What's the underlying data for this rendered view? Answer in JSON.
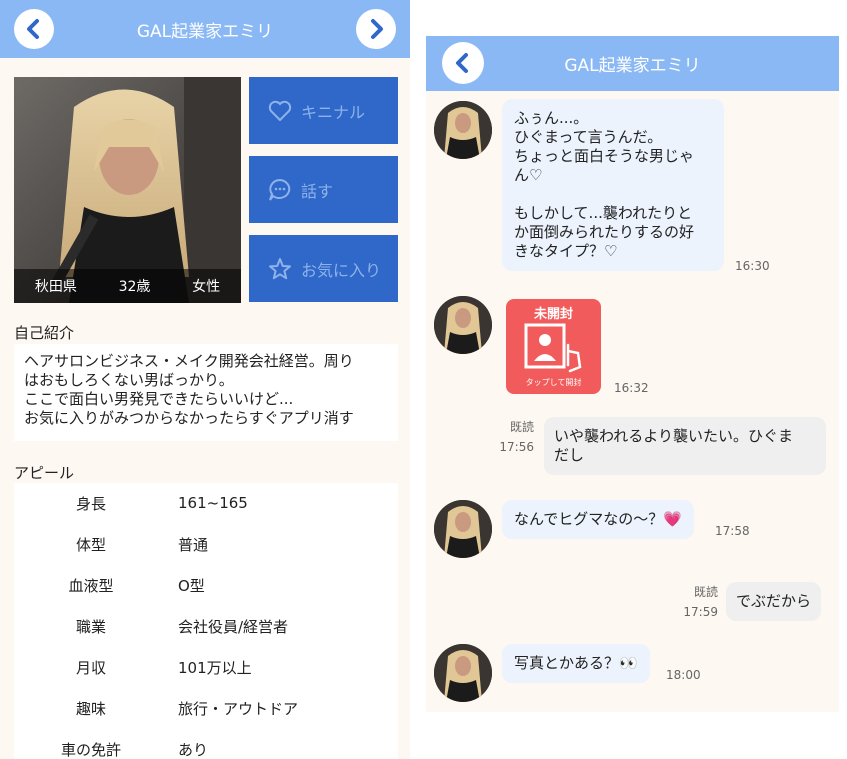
{
  "left_panel": {
    "title": "GAL起業家エミリ",
    "profile": {
      "prefecture": "秋田県",
      "age": "32歳",
      "gender": "女性"
    },
    "actions": {
      "like": "キニナル",
      "talk": "話す",
      "favorite": "お気に入り"
    },
    "intro_label": "自己紹介",
    "intro_lines": [
      "ヘアサロンビジネス・メイク開発会社経営。周り",
      "はおもしろくない男ばっかり。",
      "ここで面白い男発見できたらいいけど...",
      "お気に入りがみつからなかったらすぐアプリ消す"
    ],
    "appeal_label": "アピール",
    "appeal": [
      {
        "key": "身長",
        "value": "161~165"
      },
      {
        "key": "体型",
        "value": "普通"
      },
      {
        "key": "血液型",
        "value": "O型"
      },
      {
        "key": "職業",
        "value": "会社役員/経営者"
      },
      {
        "key": "月収",
        "value": "101万以上"
      },
      {
        "key": "趣味",
        "value": "旅行・アウトドア"
      },
      {
        "key": "車の免許",
        "value": "あり"
      }
    ]
  },
  "right_panel": {
    "title": "GAL起業家エミリ",
    "messages": [
      {
        "lines": [
          "ふぅん...。",
          "ひぐまって言うんだ。",
          "ちょっと面白そうな男じゃ",
          "ん♡",
          "",
          "もしかして...襲われたりと",
          "か面倒みられたりするの好",
          "きなタイプ？♡"
        ],
        "time": "16:30"
      },
      {
        "sticker_top": "未開封",
        "sticker_bottom": "タップして開封",
        "time": "16:32"
      },
      {
        "read": "既読",
        "time": "17:56",
        "lines": [
          "いや襲われるより襲いたい。ひぐま",
          "だし"
        ]
      },
      {
        "lines": [
          "なんでヒグマなの〜？💗"
        ],
        "time": "17:58"
      },
      {
        "read": "既読",
        "time": "17:59",
        "lines": [
          "でぶだから"
        ]
      },
      {
        "lines": [
          "写真とかある？👀"
        ],
        "time": "18:00"
      }
    ]
  },
  "colors": {
    "header": "#8ab8f5",
    "action_button": "#2f68c9",
    "background": "#fdf8f2",
    "incoming_bubble": "#ecf3fd",
    "outgoing_bubble": "#efefef",
    "sticker": "#f25b5b"
  }
}
